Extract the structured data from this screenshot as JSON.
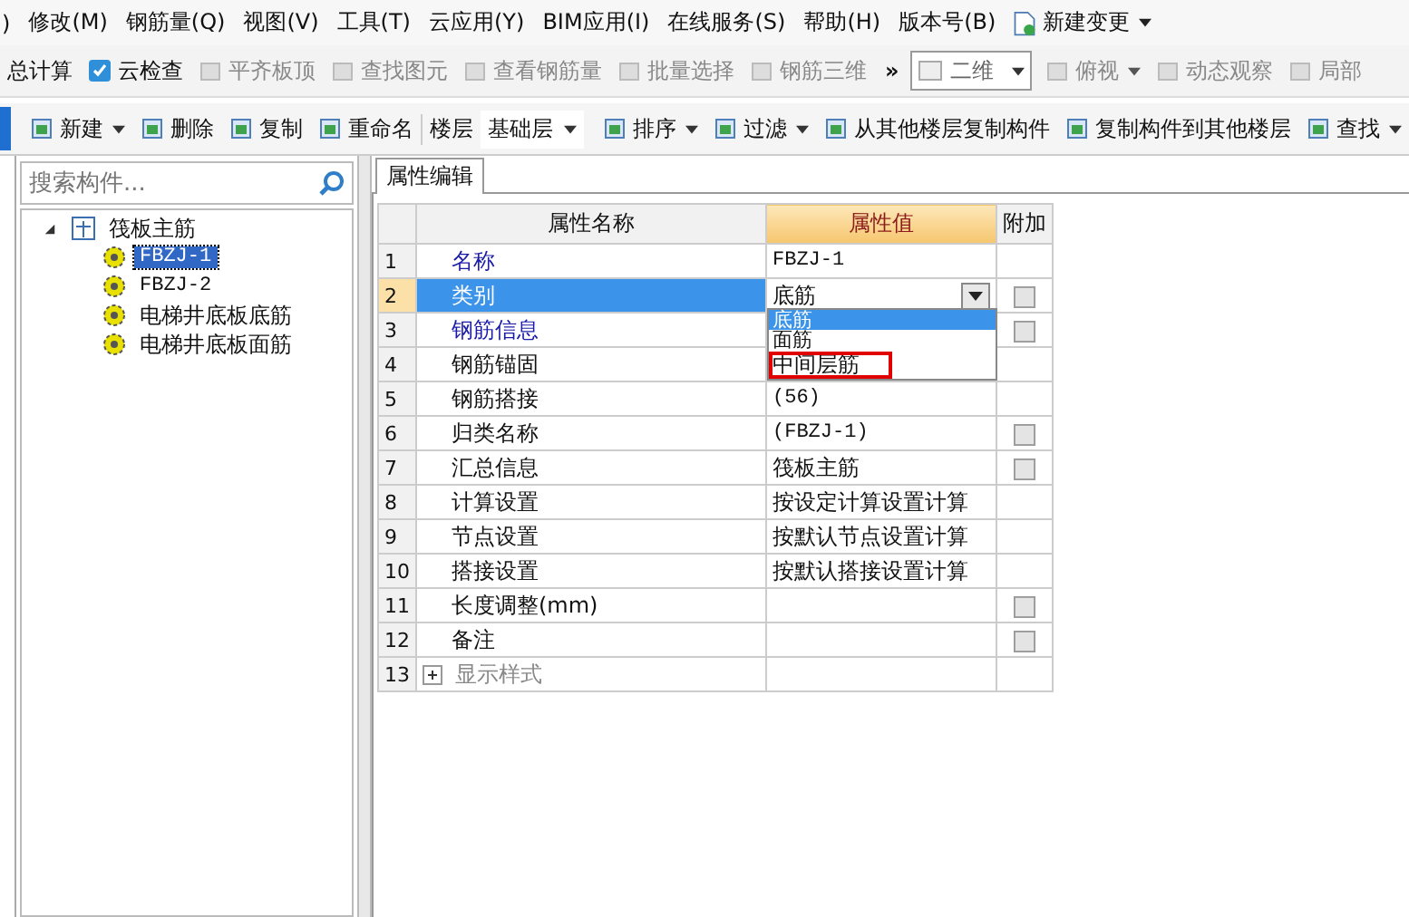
{
  "menu": [
    ")",
    "修改(M)",
    "钢筋量(Q)",
    "视图(V)",
    "工具(T)",
    "云应用(Y)",
    "BIM应用(I)",
    "在线服务(S)",
    "帮助(H)",
    "版本号(B)"
  ],
  "menu_action": {
    "label": "新建变更"
  },
  "toolbar_main": [
    {
      "label": "总计算",
      "kind": "text",
      "disabled": false
    },
    {
      "label": "云检查",
      "kind": "button",
      "disabled": false
    },
    {
      "label": "平齐板顶",
      "kind": "button",
      "disabled": true
    },
    {
      "label": "查找图元",
      "kind": "button",
      "disabled": true
    },
    {
      "label": "查看钢筋量",
      "kind": "button",
      "disabled": true
    },
    {
      "label": "批量选择",
      "kind": "button",
      "disabled": true
    },
    {
      "label": "钢筋三维",
      "kind": "button",
      "disabled": true
    },
    {
      "label": "»",
      "kind": "more",
      "disabled": false
    },
    {
      "label": "二维",
      "kind": "select",
      "disabled": true
    },
    {
      "label": "俯视",
      "kind": "dropdown",
      "disabled": true
    },
    {
      "label": "动态观察",
      "kind": "button",
      "disabled": true
    },
    {
      "label": "局部",
      "kind": "button",
      "disabled": true
    }
  ],
  "toolbar_component": [
    {
      "label": "新建",
      "kind": "dropdown"
    },
    {
      "label": "删除",
      "kind": "button"
    },
    {
      "label": "复制",
      "kind": "button"
    },
    {
      "label": "重命名",
      "kind": "button"
    },
    {
      "label": "楼层",
      "kind": "label"
    },
    {
      "label": "基础层",
      "kind": "select"
    },
    {
      "label": "排序",
      "kind": "dropdown"
    },
    {
      "label": "过滤",
      "kind": "dropdown"
    },
    {
      "label": "从其他楼层复制构件",
      "kind": "button"
    },
    {
      "label": "复制构件到其他楼层",
      "kind": "button"
    },
    {
      "label": "查找",
      "kind": "dropdown"
    }
  ],
  "search": {
    "placeholder": "搜索构件..."
  },
  "tree": [
    {
      "label": "筏板主筋",
      "expanded": true,
      "selected": false,
      "children": [
        {
          "label": "FBZJ-1",
          "selected": true
        },
        {
          "label": "FBZJ-2",
          "selected": false
        },
        {
          "label": "电梯井底板底筋",
          "selected": false
        },
        {
          "label": "电梯井底板面筋",
          "selected": false
        }
      ]
    }
  ],
  "tab": {
    "label": "属性编辑",
    "selected": true
  },
  "table": {
    "columns": [
      "属性名称",
      "属性值",
      "附加"
    ],
    "rows": [
      {
        "num": "1",
        "name": "名称",
        "kind": "link",
        "value": "FBZJ-1",
        "mono": true,
        "selected": false
      },
      {
        "num": "2",
        "name": "类别",
        "kind": "link",
        "value": "底筋",
        "mono": false,
        "has_checkbox": true,
        "checked": false,
        "selected": true,
        "dropdown": true
      },
      {
        "num": "3",
        "name": "钢筋信息",
        "kind": "link",
        "has_checkbox": true,
        "checked": false,
        "selected": false
      },
      {
        "num": "4",
        "name": "钢筋锚固",
        "kind": "plain",
        "selected": false
      },
      {
        "num": "5",
        "name": "钢筋搭接",
        "kind": "plain",
        "value": "(56)",
        "mono": true,
        "selected": false
      },
      {
        "num": "6",
        "name": "归类名称",
        "kind": "plain",
        "value": "(FBZJ-1)",
        "mono": true,
        "has_checkbox": true,
        "checked": false,
        "selected": false
      },
      {
        "num": "7",
        "name": "汇总信息",
        "kind": "plain",
        "value": "筏板主筋",
        "mono": false,
        "has_checkbox": true,
        "checked": false,
        "selected": false
      },
      {
        "num": "8",
        "name": "计算设置",
        "kind": "plain",
        "value": "按设定计算设置计算",
        "mono": false,
        "selected": false
      },
      {
        "num": "9",
        "name": "节点设置",
        "kind": "plain",
        "value": "按默认节点设置计算",
        "mono": false,
        "selected": false
      },
      {
        "num": "10",
        "name": "搭接设置",
        "kind": "plain",
        "value": "按默认搭接设置计算",
        "mono": false,
        "selected": false
      },
      {
        "num": "11",
        "name": "长度调整(mm)",
        "kind": "plain",
        "has_checkbox": true,
        "checked": false,
        "selected": false
      },
      {
        "num": "12",
        "name": "备注",
        "kind": "plain",
        "has_checkbox": true,
        "checked": false,
        "selected": false
      },
      {
        "num": "13",
        "name": "显示样式",
        "kind": "group",
        "expanded": false,
        "selected": false
      }
    ]
  },
  "dropdown_options": [
    {
      "label": "底筋",
      "selected": true,
      "marked": false
    },
    {
      "label": "面筋",
      "selected": false,
      "marked": false
    },
    {
      "label": "中间层筋",
      "selected": false,
      "marked": true
    }
  ]
}
